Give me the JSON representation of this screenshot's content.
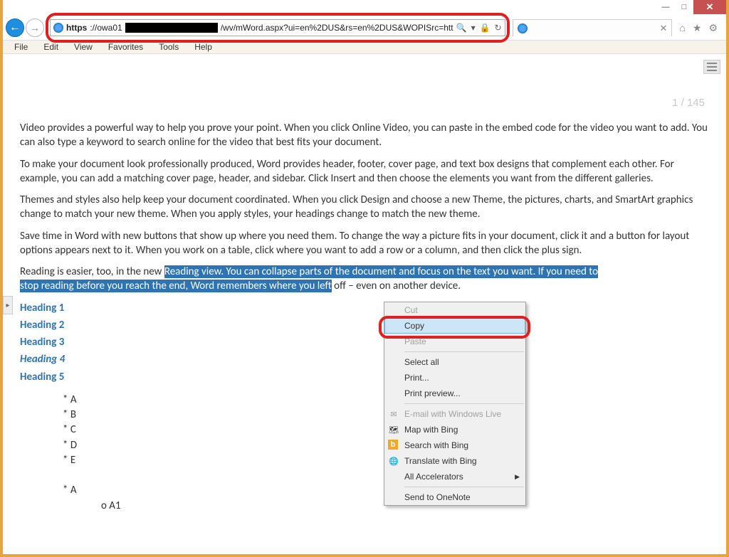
{
  "window": {
    "min_label": "—",
    "max_label": "□",
    "close_label": "✕"
  },
  "nav": {
    "back": "←",
    "forward": "→",
    "url_scheme": "https",
    "url_host": "://owa01",
    "url_tail": "/wv/mWord.aspx?ui=en%2DUS&rs=en%2DUS&WOPISrc=htt",
    "search_glyph": "🔍",
    "lock_glyph": "🔒",
    "refresh_glyph": "↻",
    "tab_close": "✕",
    "home_glyph": "⌂",
    "star_glyph": "★",
    "gear_glyph": "⚙"
  },
  "menubar": {
    "file": "File",
    "edit": "Edit",
    "view": "View",
    "favorites": "Favorites",
    "tools": "Tools",
    "help": "Help"
  },
  "page_counter": "1 / 145",
  "doc": {
    "p1": "Video provides a powerful way to help you prove your point. When you click Online Video, you can paste in the embed code for the video you want to add. You can also type a keyword to search online for the video that best fits your document.",
    "p2": "To make your document look professionally produced, Word provides header, footer, cover page, and text box designs that complement each other. For example, you can add a matching cover page, header, and sidebar. Click Insert and then choose the elements you want from the different galleries.",
    "p3": "Themes and styles also help keep your document coordinated. When you click Design and choose a new Theme, the pictures, charts, and SmartArt graphics change to match your new theme. When you apply styles, your headings change to match the new theme.",
    "p4": "Save time in Word with new buttons that show up where you need them. To change the way a picture fits in your document, click it and a button for layout options appears next to it. When you work on a table, click where you want to add a row or a column, and then click the plus sign.",
    "p5_pre": "Reading is easier, too, in the new ",
    "p5_sel1": "Reading view. You can collapse parts of the document and focus on the text you want. If you need to ",
    "p5_sel2": "stop reading before you reach the end, Word remembers where you left",
    "p5_post": " off – even on another device.",
    "h1": "Heading 1",
    "h2": "Heading 2",
    "h3": "Heading 3",
    "h4": "Heading 4",
    "h5": "Heading 5",
    "b1": "* A",
    "b2": "* B",
    "b3": "* C",
    "b4": "* D",
    "b5": "* E",
    "b6": "* A",
    "sb1": "o A1"
  },
  "ctx": {
    "cut": "Cut",
    "copy": "Copy",
    "paste": "Paste",
    "select_all": "Select all",
    "print": "Print...",
    "print_preview": "Print preview...",
    "email": "E-mail with Windows Live",
    "map": "Map with Bing",
    "search": "Search with Bing",
    "translate": "Translate with Bing",
    "accel": "All Accelerators",
    "onenote": "Send to OneNote"
  }
}
